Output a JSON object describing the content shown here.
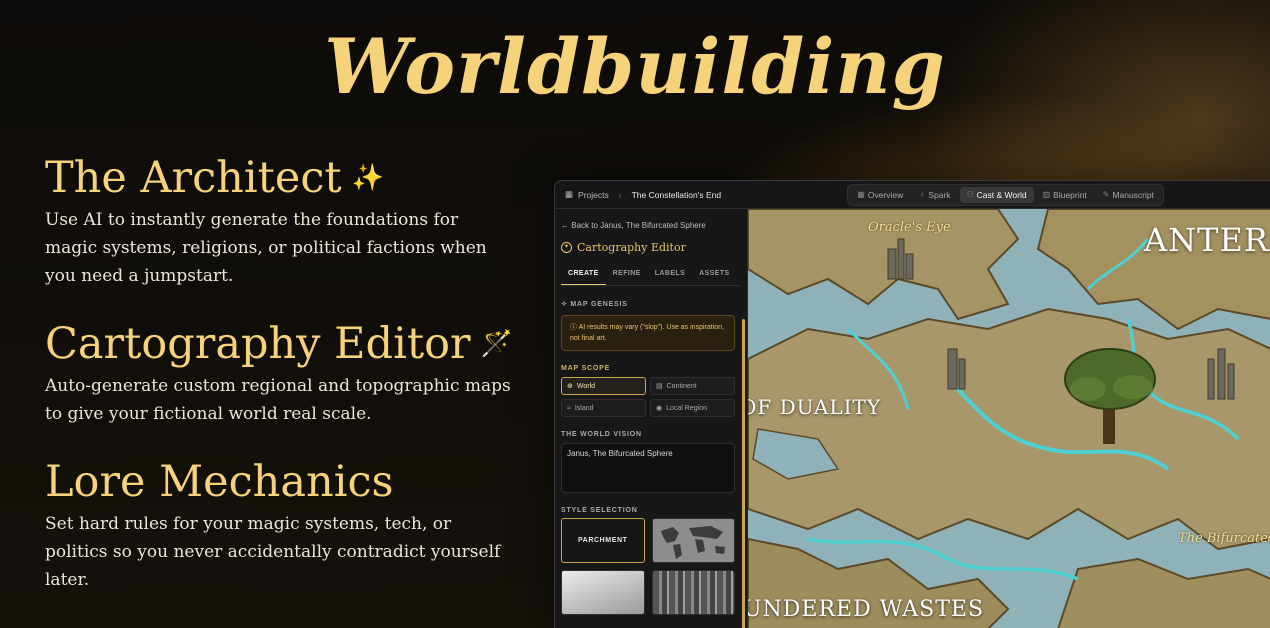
{
  "hero": {
    "title": "Worldbuilding"
  },
  "features": [
    {
      "title": "The Architect",
      "icon": "sparkles-icon",
      "icon_glyph": "✨",
      "description": "Use AI to instantly generate the foundations for magic systems, religions, or political factions when you need a jumpstart."
    },
    {
      "title": "Cartography Editor",
      "icon": "magic-wand-icon",
      "icon_glyph": "🪄",
      "description": "Auto-generate custom regional and topographic maps to give your fictional world real scale."
    },
    {
      "title": "Lore Mechanics",
      "icon": "",
      "icon_glyph": "",
      "description": "Set hard rules for your magic systems, tech, or politics so you never accidentally contradict yourself later."
    }
  ],
  "app": {
    "breadcrumb": {
      "projects": "Projects",
      "current": "The Constellation's End"
    },
    "nav_tabs": [
      {
        "label": "Overview",
        "icon": "grid-icon",
        "active": false
      },
      {
        "label": "Spark",
        "icon": "lightbulb-icon",
        "active": false
      },
      {
        "label": "Cast & World",
        "icon": "people-icon",
        "active": true
      },
      {
        "label": "Blueprint",
        "icon": "columns-icon",
        "active": false
      },
      {
        "label": "Manuscript",
        "icon": "pen-icon",
        "active": false
      }
    ],
    "sidebar": {
      "back_label": "Back to Janus, The Bifurcated Sphere",
      "editor_title": "Cartography Editor",
      "subtabs": [
        "CREATE",
        "REFINE",
        "LABELS",
        "ASSETS"
      ],
      "active_subtab": "CREATE",
      "map_genesis_label": "MAP GENESIS",
      "notice": "AI results may vary (\"slop\"). Use as inspiration, not final art.",
      "map_scope_label": "MAP SCOPE",
      "scopes": [
        "World",
        "Continent",
        "Island",
        "Local Region"
      ],
      "active_scope": "World",
      "world_vision_label": "THE WORLD VISION",
      "world_vision_value": "Janus, The Bifurcated Sphere",
      "style_selection_label": "STYLE SELECTION",
      "styles": [
        "PARCHMENT"
      ]
    },
    "map": {
      "labels": {
        "oracle": "Oracle's Eye",
        "antera": "ANTERA",
        "duality": "OF DUALITY",
        "bifurcated": "The Bifurcated",
        "wastes": "UNDERED WASTES"
      }
    }
  },
  "colors": {
    "accent": "#f6d37a",
    "gold": "#e9c46a",
    "map_water": "#7fa7b2",
    "map_land": "#a5935f"
  }
}
